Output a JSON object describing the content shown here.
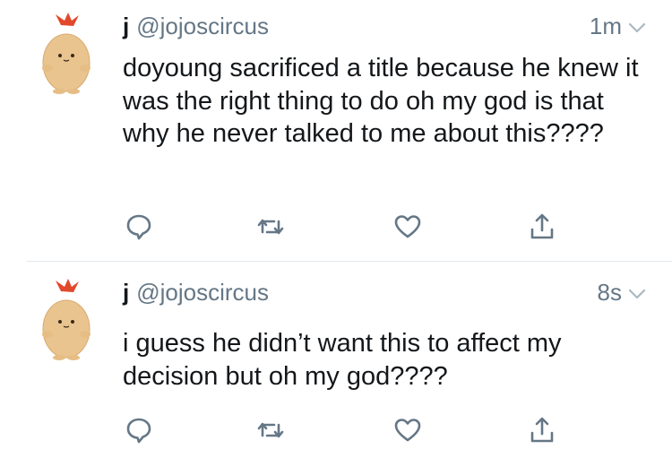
{
  "tweets": [
    {
      "name": "j",
      "handle": "@jojoscircus",
      "time": "1m",
      "text": "doyoung sacrificed a title because he knew it was the right thing to do oh my god is that why he never talked to me about this????"
    },
    {
      "name": "j",
      "handle": "@jojoscircus",
      "time": "8s",
      "text": "i guess he didn’t want this to affect my decision but oh my god????"
    }
  ],
  "icons": {
    "reply": "reply-icon",
    "retweet": "retweet-icon",
    "like": "heart-icon",
    "share": "share-icon",
    "menu": "chevron-down-icon"
  },
  "colors": {
    "text": "#14171a",
    "secondary": "#657786",
    "divider": "#e1e8ed",
    "avatar_body": "#e9c48f",
    "avatar_tail": "#e2482a"
  }
}
